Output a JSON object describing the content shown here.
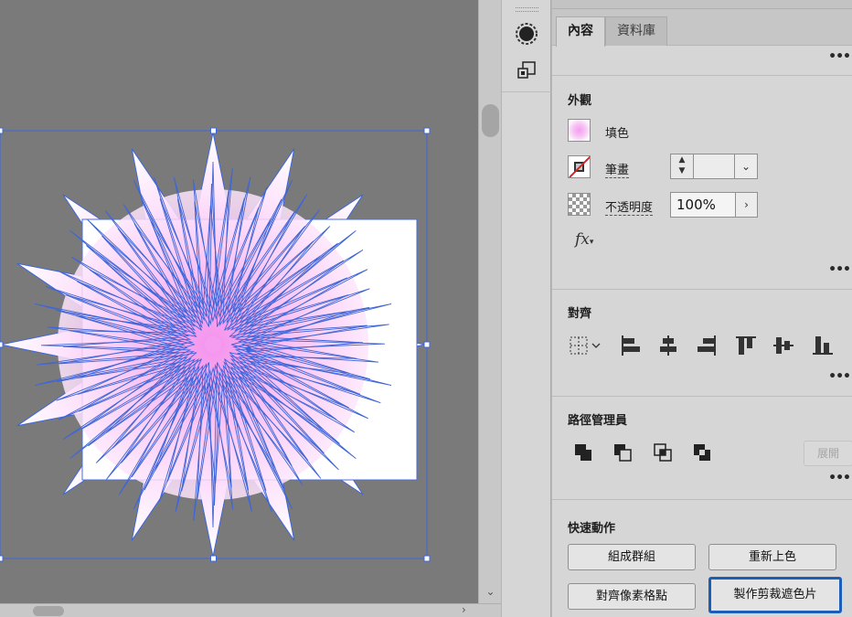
{
  "panel": {
    "tabs": [
      {
        "label": "內容",
        "active": true
      },
      {
        "label": "資料庫",
        "active": false
      }
    ],
    "appearance": {
      "title": "外觀",
      "fill_label": "填色",
      "stroke_label": "筆畫",
      "opacity_label": "不透明度",
      "opacity_value": "100%",
      "fx_label": "fx"
    },
    "align": {
      "title": "對齊"
    },
    "pathfinder": {
      "title": "路徑管理員",
      "expand_label": "展開"
    },
    "quick_actions": {
      "title": "快速動作",
      "group_label": "組成群組",
      "recolor_label": "重新上色",
      "pixel_align_label": "對齊像素格點",
      "clip_mask_label": "製作剪裁遮色片"
    }
  },
  "colors": {
    "canvas_bg": "#7a7a7a",
    "selection": "#3f66d8",
    "star_pink": "#f59cf0",
    "focus_ring": "#1b5eb8"
  },
  "icons": [
    "gear-icon",
    "artboard-icon",
    "align-grid-icon",
    "align-left-icon",
    "align-hcenter-icon",
    "align-right-icon",
    "align-top-icon",
    "align-vcenter-icon",
    "align-bottom-icon",
    "unite-icon",
    "minus-front-icon",
    "intersect-icon",
    "exclude-icon"
  ]
}
